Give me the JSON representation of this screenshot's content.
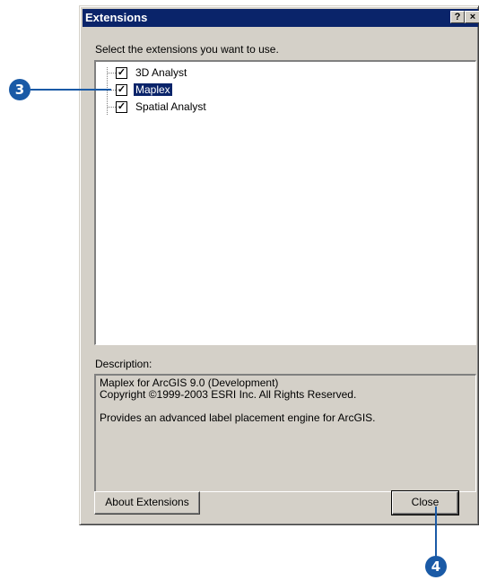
{
  "window": {
    "title": "Extensions",
    "help_label": "?",
    "close_label": "×"
  },
  "prompt": "Select the extensions you want to use.",
  "extensions": [
    {
      "label": "3D Analyst",
      "checked": true,
      "selected": false
    },
    {
      "label": "Maplex",
      "checked": true,
      "selected": true
    },
    {
      "label": "Spatial Analyst",
      "checked": true,
      "selected": false
    }
  ],
  "check_mark": "✓",
  "description": {
    "label": "Description:",
    "line1": "Maplex for ArcGIS 9.0 (Development)",
    "line2": "Copyright ©1999-2003 ESRI Inc. All Rights Reserved.",
    "line3": "Provides an advanced label placement engine for ArcGIS."
  },
  "buttons": {
    "about": "About Extensions",
    "close": "Close"
  },
  "callouts": {
    "step3": "3",
    "step4": "4"
  },
  "colors": {
    "titlebar": "#0a246a",
    "selection": "#0a246a",
    "callout": "#1a5aa6",
    "dialog": "#d4d0c8"
  }
}
